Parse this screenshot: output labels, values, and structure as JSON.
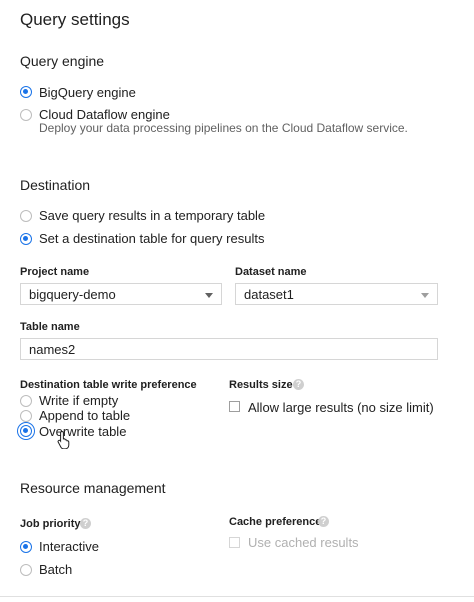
{
  "page": {
    "title": "Query settings"
  },
  "query_engine": {
    "heading": "Query engine",
    "options": [
      {
        "label": "BigQuery engine",
        "selected": true
      },
      {
        "label": "Cloud Dataflow engine",
        "selected": false,
        "description": "Deploy your data processing pipelines on the Cloud Dataflow service."
      }
    ]
  },
  "destination": {
    "heading": "Destination",
    "options": [
      {
        "label": "Save query results in a temporary table",
        "selected": false
      },
      {
        "label": "Set a destination table for query results",
        "selected": true
      }
    ],
    "project": {
      "label": "Project name",
      "value": "bigquery-demo"
    },
    "dataset": {
      "label": "Dataset name",
      "value": "dataset1"
    },
    "table": {
      "label": "Table name",
      "value": "names2"
    },
    "write_preference": {
      "label": "Destination table write preference",
      "options": [
        {
          "label": "Write if empty",
          "selected": false
        },
        {
          "label": "Append to table",
          "selected": false
        },
        {
          "label": "Overwrite table",
          "selected": true
        }
      ]
    },
    "results_size": {
      "label": "Results size",
      "help_icon": "help-icon",
      "checkbox_label": "Allow large results (no size limit)",
      "checked": false
    }
  },
  "resource_management": {
    "heading": "Resource management",
    "job_priority": {
      "label": "Job priority",
      "help_icon": "help-icon",
      "options": [
        {
          "label": "Interactive",
          "selected": true
        },
        {
          "label": "Batch",
          "selected": false
        }
      ]
    },
    "cache_preference": {
      "label": "Cache preference",
      "help_icon": "help-icon",
      "checkbox_label": "Use cached results",
      "checked": false,
      "disabled": true
    }
  },
  "colors": {
    "accent": "#1a73e8",
    "text": "#212121",
    "muted": "#616161",
    "border": "#d6d6d6"
  }
}
